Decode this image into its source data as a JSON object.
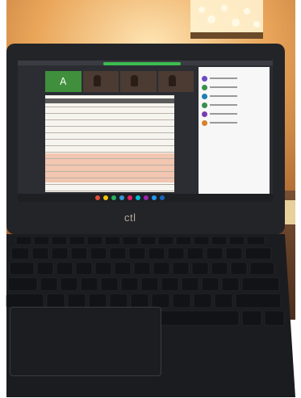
{
  "laptop": {
    "brand_logo": "ctl",
    "screen_content": {
      "tile_initial": "A",
      "participants_count": 6,
      "taskbar_icon_colors": [
        "#e74c3c",
        "#f1c40f",
        "#27ae60",
        "#3498db",
        "#e91e63",
        "#00bcd4",
        "#9c27b0",
        "#2196f3",
        "#1565c0"
      ],
      "participant_colors": [
        "#6a4bc4",
        "#3a8e4e",
        "#1e7fb3",
        "#3a8e4e",
        "#7a3bb0",
        "#d9822b"
      ]
    }
  },
  "colors": {
    "lamp_glow": "#f4c983",
    "laptop_body": "#222327",
    "keys": "#151619"
  }
}
